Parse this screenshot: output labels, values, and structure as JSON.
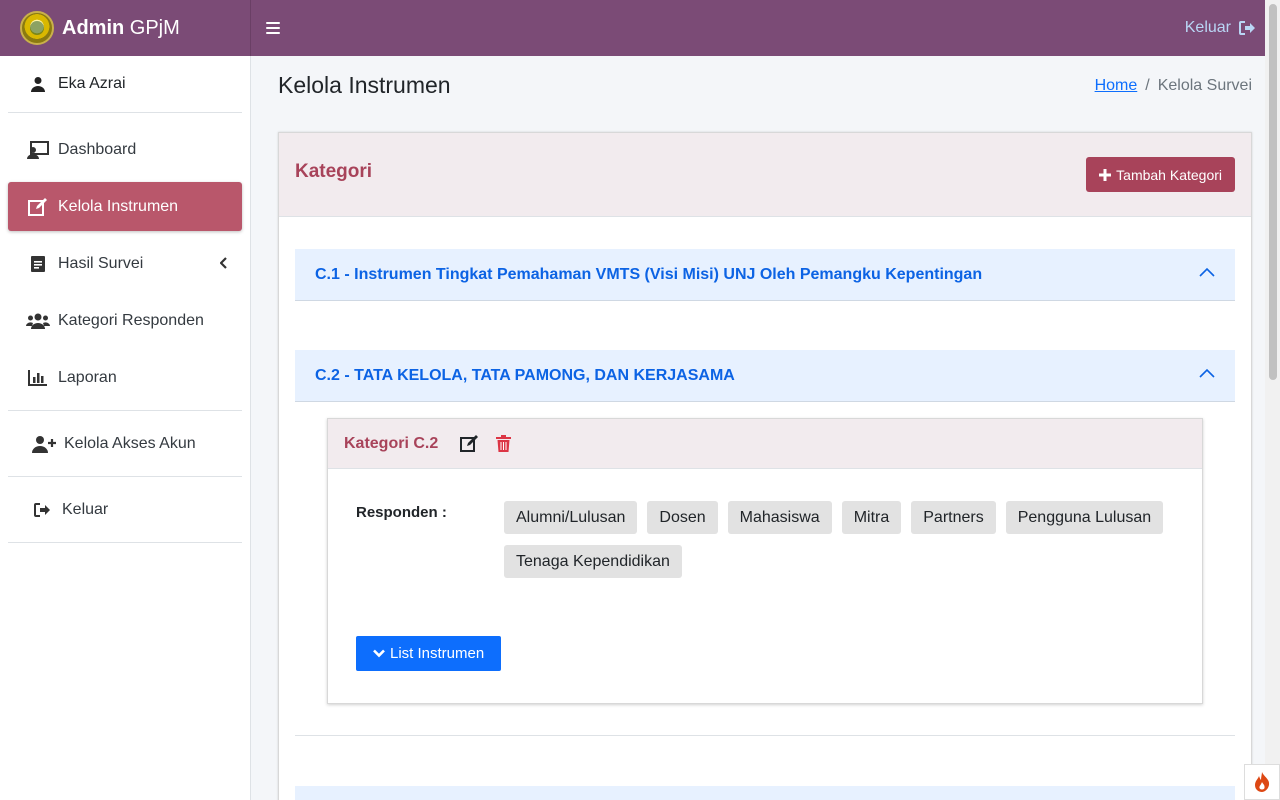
{
  "brand": {
    "bold": "Admin",
    "light": "GPjM"
  },
  "topbar": {
    "logout_label": "Keluar"
  },
  "sidebar": {
    "user": "Eka Azrai",
    "items": [
      {
        "label": "Dashboard",
        "icon": "dashboard-icon"
      },
      {
        "label": "Kelola Instrumen",
        "icon": "edit-icon",
        "active": true
      },
      {
        "label": "Hasil Survei",
        "icon": "file-icon"
      },
      {
        "label": "Kategori Responden",
        "icon": "users-icon"
      },
      {
        "label": "Laporan",
        "icon": "chart-icon"
      }
    ],
    "account": {
      "label": "Kelola Akses Akun",
      "icon": "user-plus-icon"
    },
    "logout": {
      "label": "Keluar",
      "icon": "sign-out-icon"
    }
  },
  "page": {
    "title": "Kelola Instrumen"
  },
  "breadcrumb": {
    "home": "Home",
    "separator": "/",
    "current": "Kelola Survei"
  },
  "card": {
    "title": "Kategori",
    "add_button": "Tambah Kategori",
    "accordions": [
      {
        "label": "C.1 - Instrumen Tingkat Pemahaman VMTS (Visi Misi) UNJ Oleh Pemangku Kepentingan"
      },
      {
        "label": "C.2 - TATA KELOLA, TATA PAMONG, DAN KERJASAMA"
      }
    ],
    "detail": {
      "title": "Kategori C.2",
      "respondent_label": "Responden :",
      "respondents": [
        "Alumni/Lulusan",
        "Dosen",
        "Mahasiswa",
        "Mitra",
        "Partners",
        "Pengguna Lulusan",
        "Tenaga Kependidikan"
      ],
      "list_button": "List Instrumen"
    }
  },
  "colors": {
    "topbar": "#7b4b76",
    "accent": "#a8435a",
    "active_nav": "#b9576b",
    "primary": "#0d6efd",
    "accordion_bg": "#e7f1ff"
  }
}
